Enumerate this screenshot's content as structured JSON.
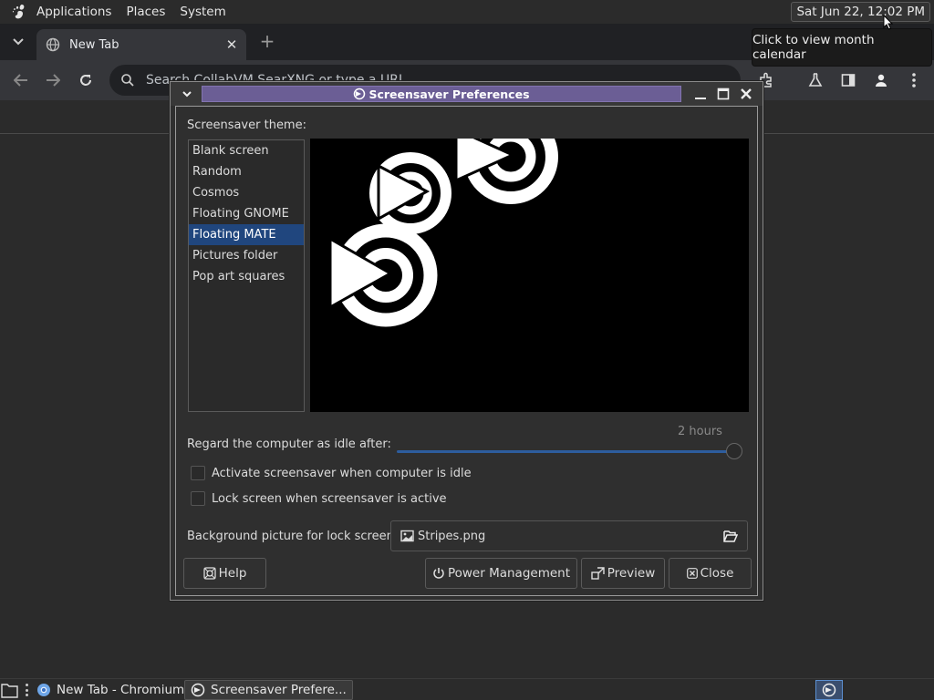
{
  "top_panel": {
    "menus": [
      "Applications",
      "Places",
      "System"
    ],
    "clock": "Sat Jun 22, 12:02 PM",
    "tooltip": "Click to view month calendar"
  },
  "browser": {
    "tab_title": "New Tab",
    "omnibox_placeholder": "Search CollabVM SearXNG or type a URL"
  },
  "dialog": {
    "title": "Screensaver Preferences",
    "theme_label": "Screensaver theme:",
    "themes": [
      "Blank screen",
      "Random",
      "Cosmos",
      "Floating GNOME",
      "Floating MATE",
      "Pictures folder",
      "Pop art squares"
    ],
    "selected_theme": "Floating MATE",
    "idle_label": "Regard the computer as idle after:",
    "idle_value": "2 hours",
    "idle_fraction": 1.0,
    "activate_label": "Activate screensaver when computer is idle",
    "activate_checked": false,
    "lock_label": "Lock screen when screensaver is active",
    "lock_checked": false,
    "background_label": "Background picture for lock screen:",
    "background_file": "Stripes.png",
    "buttons": {
      "help": "Help",
      "power": "Power Management",
      "preview": "Preview",
      "close": "Close"
    }
  },
  "taskbar": {
    "tasks": [
      "New Tab - Chromium",
      "Screensaver Prefere..."
    ]
  },
  "colors": {
    "selection": "#20467e",
    "title_strip": "#6b5e95",
    "slider": "#2d5d9e"
  }
}
